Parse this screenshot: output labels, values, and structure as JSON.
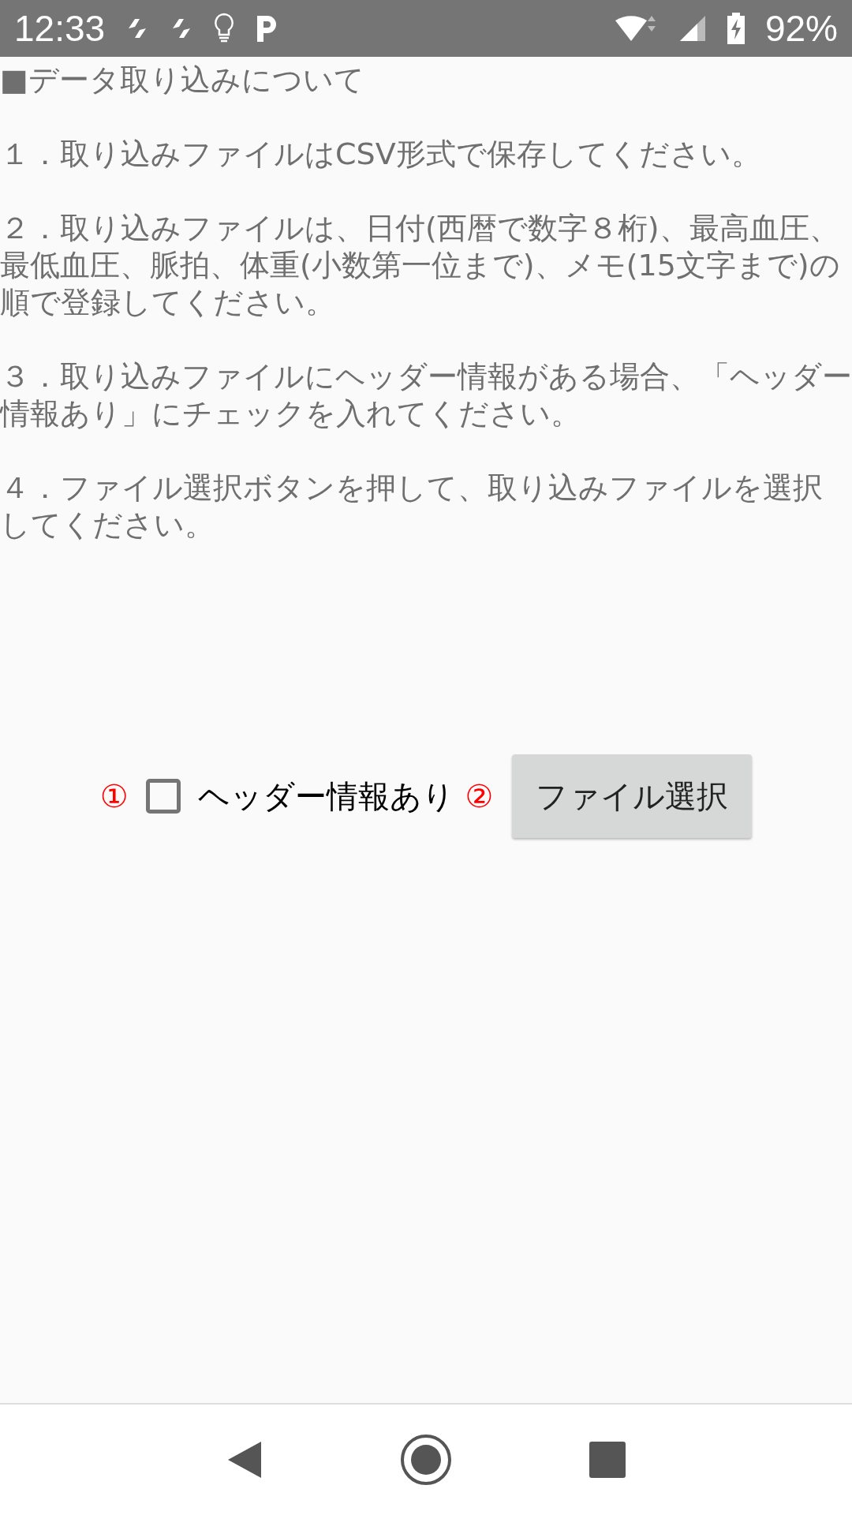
{
  "status_bar": {
    "time": "12:33",
    "battery": "92%"
  },
  "heading": "■データ取り込みについて",
  "instructions": [
    "１．取り込みファイルはCSV形式で保存してください。",
    "２．取り込みファイルは、日付(西暦で数字８桁)、最高血圧、最低血圧、脈拍、体重(小数第一位まで)、メモ(15文字まで)の順で登録してください。",
    "３．取り込みファイルにヘッダー情報がある場合、「ヘッダー情報あり」にチェックを入れてください。",
    "４．ファイル選択ボタンを押して、取り込みファイルを選択してください。"
  ],
  "header_checkbox": {
    "marker": "①",
    "label": "ヘッダー情報あり",
    "checked": false
  },
  "file_button": {
    "marker": "②",
    "label": "ファイル選択"
  }
}
